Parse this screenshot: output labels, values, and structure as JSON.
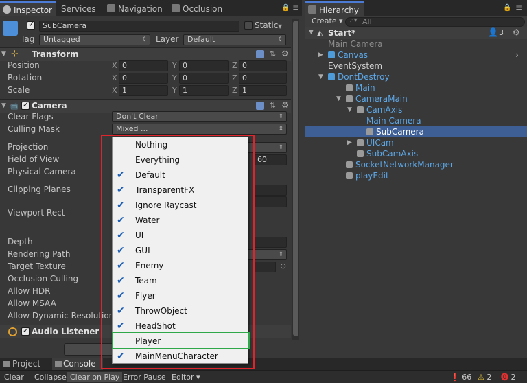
{
  "inspector_tabs": [
    {
      "label": "Inspector",
      "active": true
    },
    {
      "label": "Services",
      "active": false
    },
    {
      "label": "Navigation",
      "active": false
    },
    {
      "label": "Occlusion",
      "active": false
    }
  ],
  "object": {
    "name": "SubCamera",
    "static_label": "Static",
    "tag_label": "Tag",
    "tag_value": "Untagged",
    "layer_label": "Layer",
    "layer_value": "Default"
  },
  "transform": {
    "title": "Transform",
    "rows": [
      {
        "label": "Position",
        "x": "0",
        "y": "0",
        "z": "0"
      },
      {
        "label": "Rotation",
        "x": "0",
        "y": "0",
        "z": "0"
      },
      {
        "label": "Scale",
        "x": "1",
        "y": "1",
        "z": "1"
      }
    ],
    "axis_x": "X",
    "axis_y": "Y",
    "axis_z": "Z"
  },
  "camera": {
    "title": "Camera",
    "clear_flags_label": "Clear Flags",
    "clear_flags_value": "Don't Clear",
    "culling_mask_label": "Culling Mask",
    "culling_mask_value": "Mixed ...",
    "projection_label": "Projection",
    "fov_label": "Field of View",
    "fov_value": "60",
    "physical_label": "Physical Camera",
    "clipping_label": "Clipping Planes",
    "viewport_label": "Viewport Rect",
    "depth_label": "Depth",
    "rendering_label": "Rendering Path",
    "target_label": "Target Texture",
    "occlusion_label": "Occlusion Culling",
    "hdr_label": "Allow HDR",
    "msaa_label": "Allow MSAA",
    "dynres_label": "Allow Dynamic Resolution"
  },
  "audio_listener": {
    "title": "Audio Listener"
  },
  "culling_menu": {
    "items": [
      {
        "label": "Nothing",
        "checked": false
      },
      {
        "label": "Everything",
        "checked": false
      },
      {
        "label": "Default",
        "checked": true
      },
      {
        "label": "TransparentFX",
        "checked": true
      },
      {
        "label": "Ignore Raycast",
        "checked": true
      },
      {
        "label": "Water",
        "checked": true
      },
      {
        "label": "UI",
        "checked": true
      },
      {
        "label": "GUI",
        "checked": true
      },
      {
        "label": "Enemy",
        "checked": true
      },
      {
        "label": "Team",
        "checked": true
      },
      {
        "label": "Flyer",
        "checked": true
      },
      {
        "label": "ThrowObject",
        "checked": true
      },
      {
        "label": "HeadShot",
        "checked": true
      },
      {
        "label": "Player",
        "checked": false
      },
      {
        "label": "MainMenuCharacter",
        "checked": true
      }
    ]
  },
  "hierarchy": {
    "tab_label": "Hierarchy",
    "create_label": "Create",
    "search_placeholder": "All",
    "scene_name": "Start*",
    "scene_count": "3",
    "items": [
      {
        "label": "Main Camera",
        "color": "#8c8c8c"
      },
      {
        "label": "Canvas",
        "color": "#5da7e6"
      },
      {
        "label": "EventSystem",
        "color": "#d0d0d0"
      },
      {
        "label": "DontDestroy",
        "color": "#5da7e6"
      },
      {
        "label": "Main",
        "color": "#5da7e6"
      },
      {
        "label": "CameraMain",
        "color": "#5da7e6"
      },
      {
        "label": "CamAxis",
        "color": "#5da7e6"
      },
      {
        "label": "Main Camera",
        "color": "#5da7e6"
      },
      {
        "label": "SubCamera",
        "color": "#ffffff"
      },
      {
        "label": "UICam",
        "color": "#5da7e6"
      },
      {
        "label": "SubCamAxis",
        "color": "#5da7e6"
      },
      {
        "label": "SocketNetworkManager",
        "color": "#5da7e6"
      },
      {
        "label": "playEdit",
        "color": "#5da7e6"
      }
    ]
  },
  "bottom_tabs": {
    "project": "Project",
    "console": "Console"
  },
  "console_bar": {
    "clear": "Clear",
    "collapse": "Collapse",
    "clear_on_play": "Clear on Play",
    "error_pause": "Error Pause",
    "editor": "Editor",
    "info_count": "66",
    "warn_count": "2",
    "error_count": "2"
  },
  "colors": {
    "accent": "#4c7bd6",
    "selection": "#3e5f96",
    "highlight_red": "#e0242c",
    "highlight_green": "#2fa84a"
  }
}
